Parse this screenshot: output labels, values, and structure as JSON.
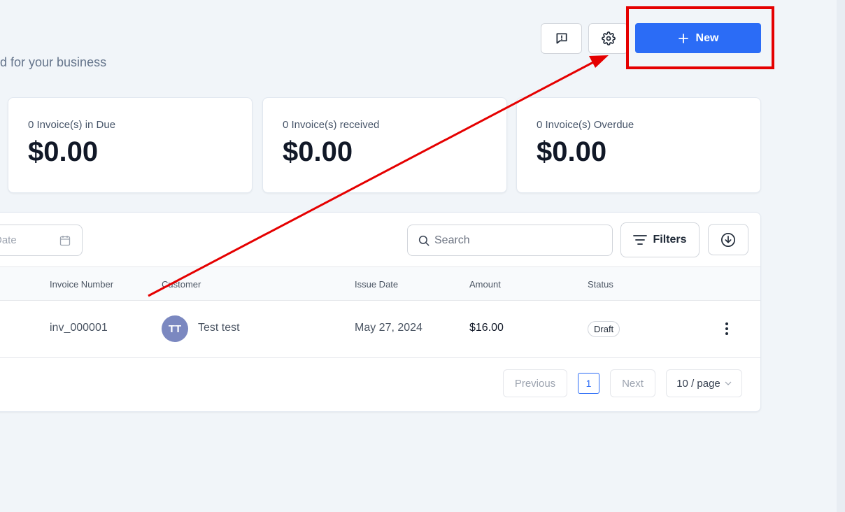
{
  "header": {
    "subtitle": "d for your business",
    "new_button_label": "New"
  },
  "stats": [
    {
      "label": "0 Invoice(s) in Due",
      "value": "$0.00"
    },
    {
      "label": "0 Invoice(s) received",
      "value": "$0.00"
    },
    {
      "label": "0 Invoice(s) Overdue",
      "value": "$0.00"
    }
  ],
  "toolbar": {
    "date_placeholder": "Date",
    "search_placeholder": "Search",
    "filters_label": "Filters"
  },
  "table": {
    "columns": [
      "Invoice Number",
      "Customer",
      "Issue Date",
      "Amount",
      "Status"
    ],
    "rows": [
      {
        "invoice_number": "inv_000001",
        "avatar_initials": "TT",
        "customer": "Test test",
        "issue_date": "May 27, 2024",
        "amount": "$16.00",
        "status": "Draft"
      }
    ]
  },
  "pagination": {
    "previous_label": "Previous",
    "current_page": "1",
    "next_label": "Next",
    "page_size": "10 / page"
  },
  "annotation": {
    "color": "#e50000"
  },
  "colors": {
    "primary": "#2b6cf6",
    "background": "#f1f5f9"
  }
}
